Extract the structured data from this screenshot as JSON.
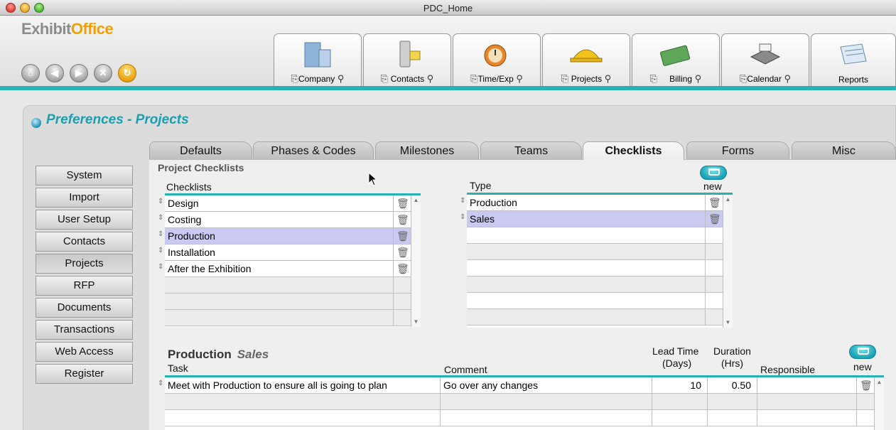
{
  "window": {
    "title": "PDC_Home"
  },
  "logo": {
    "part1": "Exhibit",
    "part2": "Office"
  },
  "main_tabs": [
    {
      "label": "Company",
      "icon": "building-icon"
    },
    {
      "label": "Contacts",
      "icon": "phone-icon"
    },
    {
      "label": "Time/Exp",
      "icon": "clock-icon"
    },
    {
      "label": "Projects",
      "icon": "hardhat-icon"
    },
    {
      "label": "Billing",
      "icon": "money-icon"
    },
    {
      "label": "Calendar",
      "icon": "calendar-icon"
    },
    {
      "label": "Reports",
      "icon": "reports-icon"
    }
  ],
  "page": {
    "title": "Preferences - Projects"
  },
  "pref_tabs": [
    "Defaults",
    "Phases & Codes",
    "Milestones",
    "Teams",
    "Checklists",
    "Forms",
    "Misc"
  ],
  "active_tab": "Checklists",
  "sidebar": [
    {
      "label": "System"
    },
    {
      "label": "Import"
    },
    {
      "label": "User Setup"
    },
    {
      "label": "Contacts"
    },
    {
      "label": "Projects"
    },
    {
      "label": "RFP"
    },
    {
      "label": "Documents"
    },
    {
      "label": "Transactions"
    },
    {
      "label": "Web Access"
    },
    {
      "label": "Register"
    }
  ],
  "checklists_section": {
    "heading": "Project Checklists",
    "checklists_header": "Checklists",
    "checklists": [
      "Design",
      "Costing",
      "Production",
      "Installation",
      "After the Exhibition"
    ],
    "selected_checklist": "Production",
    "type_header": "Type",
    "new_label": "new",
    "types": [
      "Production",
      "Sales"
    ],
    "selected_type": "Sales"
  },
  "tasks_section": {
    "title": "Production",
    "subtitle": "Sales",
    "headers": {
      "task": "Task",
      "comment": "Comment",
      "lead_time_1": "Lead Time",
      "lead_time_2": "(Days)",
      "duration_1": "Duration",
      "duration_2": "(Hrs)",
      "responsible": "Responsible",
      "new": "new"
    },
    "rows": [
      {
        "task": "Meet with Production to ensure all is going to plan",
        "comment": "Go over any changes",
        "lead_time": "10",
        "duration": "0.50",
        "responsible": ""
      }
    ]
  }
}
